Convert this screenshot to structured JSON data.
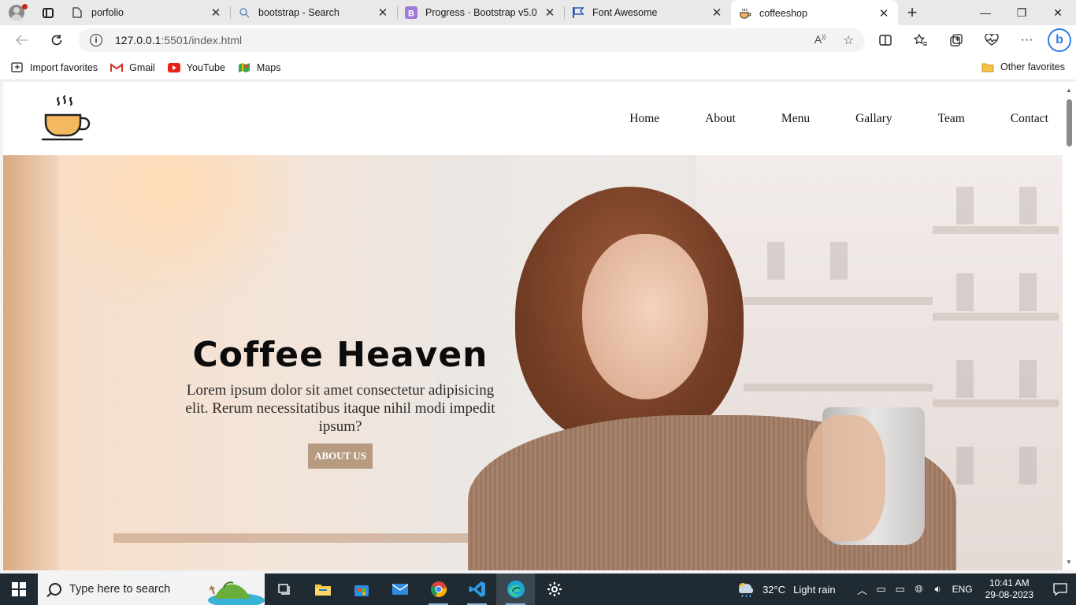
{
  "browser": {
    "tabs": [
      {
        "title": "porfolio",
        "icon": "page-icon",
        "active": false
      },
      {
        "title": "bootstrap - Search",
        "icon": "search-icon",
        "active": false
      },
      {
        "title": "Progress · Bootstrap v5.0",
        "icon": "bootstrap-icon",
        "active": false
      },
      {
        "title": "Font Awesome",
        "icon": "flag-icon",
        "active": false
      },
      {
        "title": "coffeeshop",
        "icon": "coffee-icon",
        "active": true
      }
    ],
    "url_host": "127.0.0.1",
    "url_rest": ":5501/index.html",
    "favorites": [
      {
        "label": "Import favorites",
        "icon": "import-icon"
      },
      {
        "label": "Gmail",
        "icon": "gmail-icon"
      },
      {
        "label": "YouTube",
        "icon": "youtube-icon"
      },
      {
        "label": "Maps",
        "icon": "maps-icon"
      }
    ],
    "other_favorites": "Other favorites"
  },
  "site": {
    "nav": [
      "Home",
      "About",
      "Menu",
      "Gallary",
      "Team",
      "Contact"
    ],
    "hero": {
      "title": "Coffee Heaven",
      "text": "Lorem ipsum dolor sit amet consectetur adipisicing elit. Rerum necessitatibus itaque nihil modi impedit ipsum?",
      "button": "ABOUT US"
    }
  },
  "taskbar": {
    "search_placeholder": "Type here to search",
    "weather_temp": "32°C",
    "weather_desc": "Light rain",
    "lang": "ENG",
    "time": "10:41 AM",
    "date": "29-08-2023"
  },
  "colors": {
    "accent_button": "#b79b81",
    "taskbar": "#1f2a33"
  }
}
